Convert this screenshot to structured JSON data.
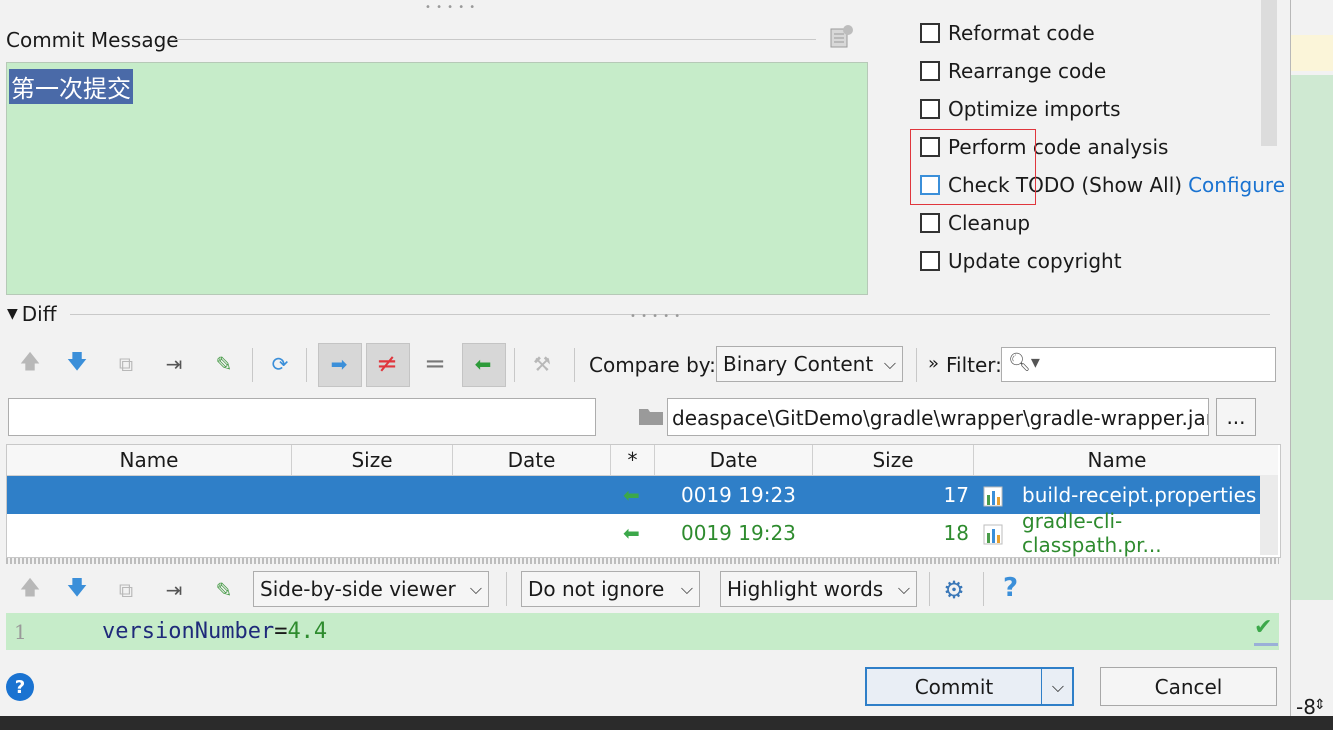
{
  "commit": {
    "label": "Commit Message",
    "text": "第一次提交"
  },
  "options": [
    {
      "label": "Reformat code"
    },
    {
      "label": "Rearrange code"
    },
    {
      "label": "Optimize imports"
    },
    {
      "label": "Perform code analysis"
    },
    {
      "label": "Check TODO (Show All)",
      "link": "Configure"
    },
    {
      "label": "Cleanup"
    },
    {
      "label": "Update copyright"
    }
  ],
  "diff": {
    "label": "Diff",
    "compare_by_label": "Compare by:",
    "compare_by_value": "Binary Content",
    "filter_label": "Filter:",
    "path": "deaspace\\GitDemo\\gradle\\wrapper\\gradle-wrapper.jar",
    "browse_label": "...",
    "columns_left": [
      "Name",
      "Size",
      "Date"
    ],
    "star_col": "*",
    "columns_right": [
      "Date",
      "Size",
      "Name"
    ],
    "rows": [
      {
        "date": "0019 19:23",
        "size": "17",
        "name": "build-receipt.properties",
        "selected": true
      },
      {
        "date": "0019 19:23",
        "size": "18",
        "name": "gradle-cli-classpath.pr...",
        "selected": false
      }
    ],
    "viewer": "Side-by-side viewer",
    "ignore": "Do not ignore",
    "highlight": "Highlight words",
    "help": "?",
    "editor_line_no": "1",
    "editor_key": "versionNumber",
    "editor_eq": "=",
    "editor_val": "4.4"
  },
  "buttons": {
    "commit": "Commit",
    "cancel": "Cancel"
  },
  "status_right": "-8",
  "colors": {
    "accent": "#2f7fc8",
    "green_bg": "#c6ecc9",
    "link": "#1a73d1"
  }
}
